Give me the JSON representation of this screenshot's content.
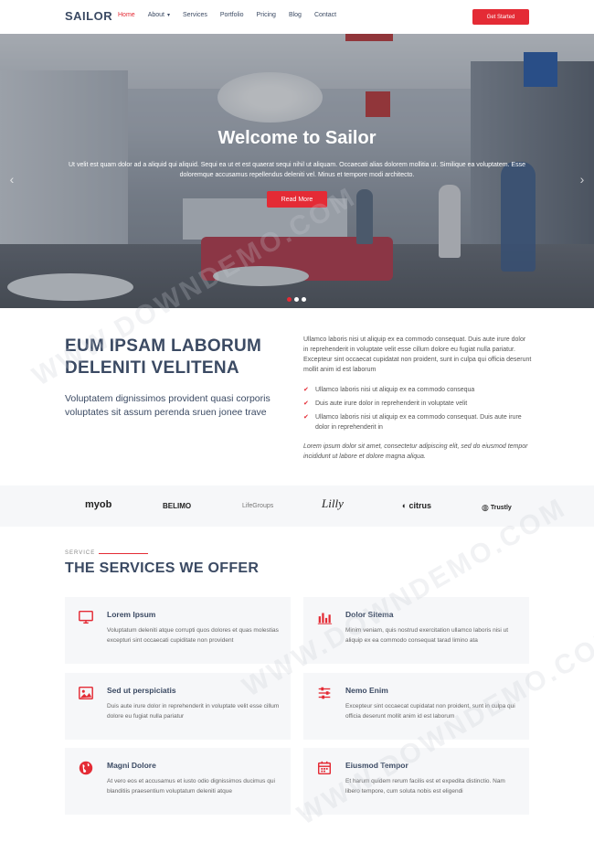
{
  "header": {
    "logo": "SAILOR",
    "nav": [
      "Home",
      "About",
      "Services",
      "Portfolio",
      "Pricing",
      "Blog",
      "Contact"
    ],
    "cta": "Get Started"
  },
  "hero": {
    "title": "Welcome to Sailor",
    "text": "Ut velit est quam dolor ad a aliquid qui aliquid. Sequi ea ut et est quaerat sequi nihil ut aliquam. Occaecati alias dolorem mollitia ut. Similique ea voluptatem. Esse doloremque accusamus repellendus deleniti vel. Minus et tempore modi architecto.",
    "button": "Read More",
    "arrow_left": "‹",
    "arrow_right": "›",
    "slides": 3,
    "active_slide": 1
  },
  "about": {
    "heading": "EUM IPSAM LABORUM DELENITI VELITENA",
    "subtext": "Voluptatem dignissimos provident quasi corporis voluptates sit assum perenda sruen jonee trave",
    "paragraph": "Ullamco laboris nisi ut aliquip ex ea commodo consequat. Duis aute irure dolor in reprehenderit in voluptate velit esse cillum dolore eu fugiat nulla pariatur. Excepteur sint occaecat cupidatat non proident, sunt in culpa qui officia deserunt mollit anim id est laborum",
    "checks": [
      "Ullamco laboris nisi ut aliquip ex ea commodo consequa",
      "Duis aute irure dolor in reprehenderit in voluptate velit",
      "Ullamco laboris nisi ut aliquip ex ea commodo consequat. Duis aute irure dolor in reprehenderit in"
    ],
    "italic": "Lorem ipsum dolor sit amet, consectetur adipiscing elit, sed do eiusmod tempor incididunt ut labore et dolore magna aliqua."
  },
  "clients": [
    "myob",
    "BELIMO",
    "LifeGroups",
    "Lilly",
    "citrus",
    "Trustly"
  ],
  "services": {
    "label": "SERVICE",
    "title": "THE SERVICES WE OFFER",
    "items": [
      {
        "title": "Lorem Ipsum",
        "text": "Voluptatum deleniti atque corrupti quos dolores et quas molestias excepturi sint occaecati cupiditate non provident",
        "icon": "monitor-icon"
      },
      {
        "title": "Dolor Sitema",
        "text": "Minim veniam, quis nostrud exercitation ullamco laboris nisi ut aliquip ex ea commodo consequat tarad limino ata",
        "icon": "bar-chart-icon"
      },
      {
        "title": "Sed ut perspiciatis",
        "text": "Duis aute irure dolor in reprehenderit in voluptate velit esse cillum dolore eu fugiat nulla pariatur",
        "icon": "image-icon"
      },
      {
        "title": "Nemo Enim",
        "text": "Excepteur sint occaecat cupidatat non proident, sunt in culpa qui officia deserunt mollit anim id est laborum",
        "icon": "sliders-icon"
      },
      {
        "title": "Magni Dolore",
        "text": "At vero eos et accusamus et iusto odio dignissimos ducimus qui blanditiis praesentium voluptatum deleniti atque",
        "icon": "globe-icon"
      },
      {
        "title": "Eiusmod Tempor",
        "text": "Et harum quidem rerum facilis est et expedita distinctio. Nam libero tempore, cum soluta nobis est eligendi",
        "icon": "calendar-icon"
      }
    ]
  },
  "watermark": "WWW.DOWNDEMO.COM",
  "colors": {
    "accent": "#e42b35",
    "heading": "#3b4a63"
  }
}
